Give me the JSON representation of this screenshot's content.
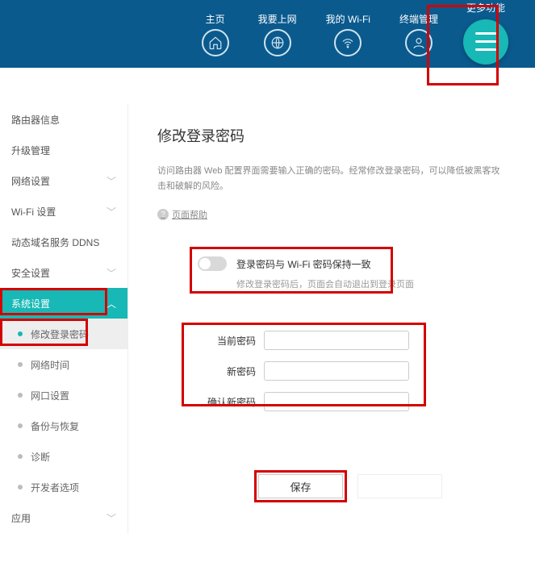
{
  "nav": {
    "home": "主页",
    "internet": "我要上网",
    "wifi": "我的 Wi-Fi",
    "devices": "终端管理",
    "more": "更多功能"
  },
  "sidebar": {
    "router_info": "路由器信息",
    "upgrade": "升级管理",
    "network": "网络设置",
    "wifi": "Wi-Fi 设置",
    "ddns": "动态域名服务 DDNS",
    "security": "安全设置",
    "system": "系统设置",
    "sub": {
      "change_pwd": "修改登录密码",
      "net_time": "网络时间",
      "port": "网口设置",
      "backup": "备份与恢复",
      "diag": "诊断",
      "dev_opts": "开发者选项"
    },
    "apps": "应用"
  },
  "page": {
    "title": "修改登录密码",
    "desc": "访问路由器 Web 配置界面需要输入正确的密码。经常修改登录密码，可以降低被黑客攻击和破解的风险。",
    "help": "页面帮助",
    "toggle_label": "登录密码与 Wi-Fi 密码保持一致",
    "toggle_hint": "修改登录密码后，页面会自动退出到登录页面",
    "fields": {
      "current": "当前密码",
      "new": "新密码",
      "confirm": "确认新密码"
    },
    "save": "保存"
  }
}
